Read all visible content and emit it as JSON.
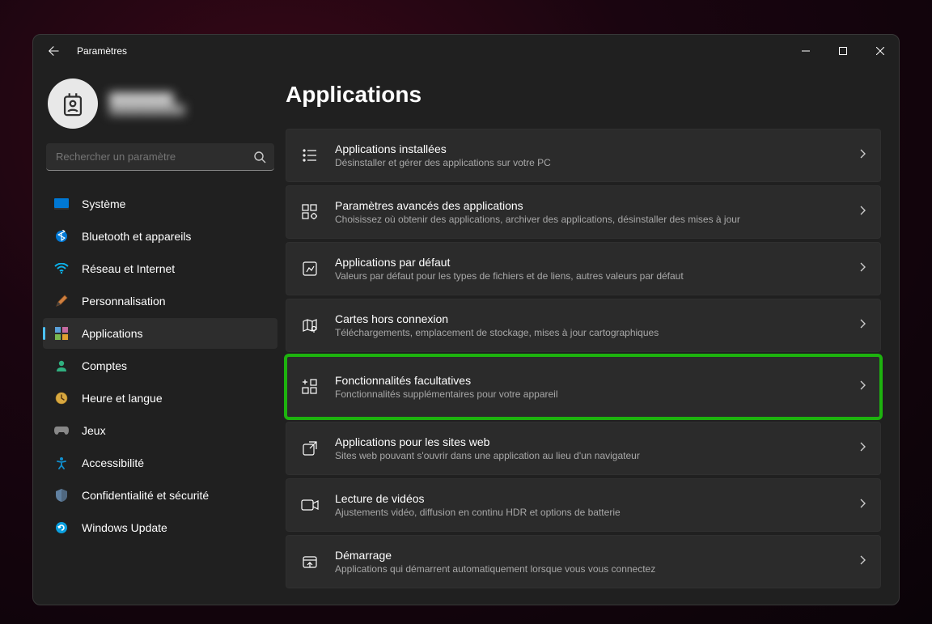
{
  "window": {
    "title": "Paramètres"
  },
  "search": {
    "placeholder": "Rechercher un paramètre"
  },
  "sidebar": {
    "items": [
      {
        "label": "Système"
      },
      {
        "label": "Bluetooth et appareils"
      },
      {
        "label": "Réseau et Internet"
      },
      {
        "label": "Personnalisation"
      },
      {
        "label": "Applications"
      },
      {
        "label": "Comptes"
      },
      {
        "label": "Heure et langue"
      },
      {
        "label": "Jeux"
      },
      {
        "label": "Accessibilité"
      },
      {
        "label": "Confidentialité et sécurité"
      },
      {
        "label": "Windows Update"
      }
    ]
  },
  "main": {
    "heading": "Applications",
    "cards": [
      {
        "title": "Applications installées",
        "sub": "Désinstaller et gérer des applications sur votre PC"
      },
      {
        "title": "Paramètres avancés des applications",
        "sub": "Choisissez où obtenir des applications, archiver des applications, désinstaller des mises à jour"
      },
      {
        "title": "Applications par défaut",
        "sub": "Valeurs par défaut pour les types de fichiers et de liens, autres valeurs par défaut"
      },
      {
        "title": "Cartes hors connexion",
        "sub": "Téléchargements, emplacement de stockage, mises à jour cartographiques"
      },
      {
        "title": "Fonctionnalités facultatives",
        "sub": "Fonctionnalités supplémentaires pour votre appareil"
      },
      {
        "title": "Applications pour les sites web",
        "sub": "Sites web pouvant s'ouvrir dans une application au lieu d'un navigateur"
      },
      {
        "title": "Lecture de vidéos",
        "sub": "Ajustements vidéo, diffusion en continu HDR et options de batterie"
      },
      {
        "title": "Démarrage",
        "sub": "Applications qui démarrent automatiquement lorsque vous vous connectez"
      }
    ]
  }
}
